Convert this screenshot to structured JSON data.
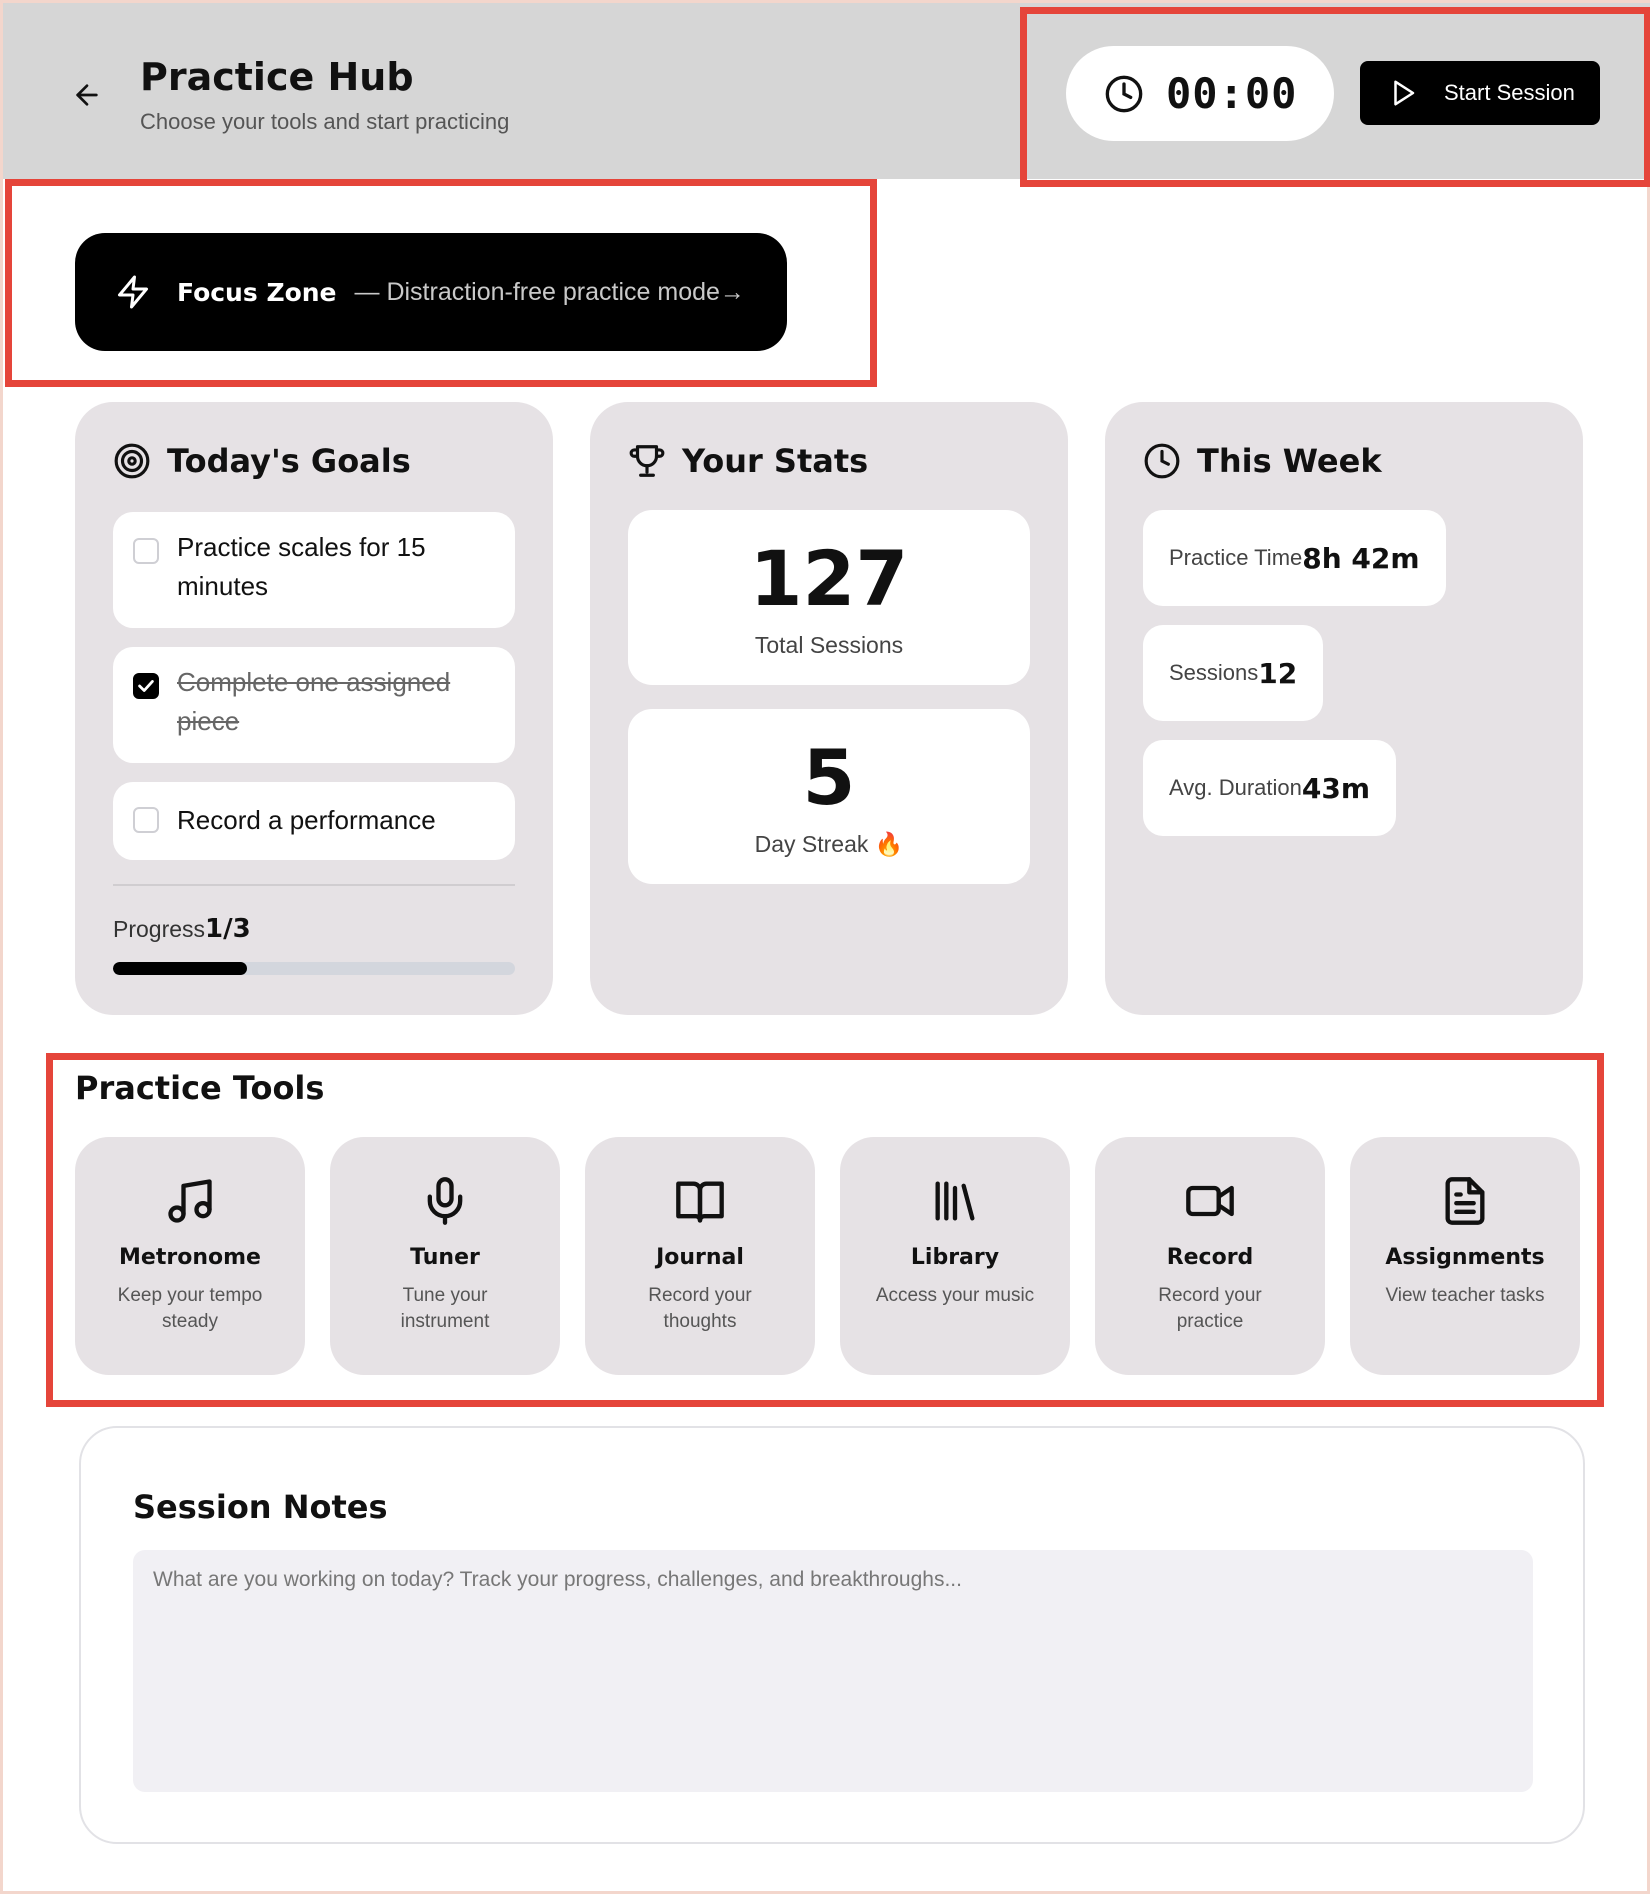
{
  "header": {
    "title": "Practice Hub",
    "subtitle": "Choose your tools and start practicing",
    "timer": "00:00",
    "start_label": "Start Session"
  },
  "focus": {
    "label": "Focus Zone",
    "description": "— Distraction-free practice mode→"
  },
  "goals": {
    "title": "Today's Goals",
    "items": [
      {
        "text": "Practice scales for 15 minutes",
        "checked": false
      },
      {
        "text": "Complete one assigned piece",
        "checked": true
      },
      {
        "text": "Record a performance",
        "checked": false
      }
    ],
    "progress_label": "Progress",
    "progress_value": "1/3",
    "progress_fraction": 0.333
  },
  "stats": {
    "title": "Your Stats",
    "total_sessions": "127",
    "total_sessions_label": "Total Sessions",
    "streak": "5",
    "streak_label": "Day Streak 🔥"
  },
  "week": {
    "title": "This Week",
    "practice_time_label": "Practice Time",
    "practice_time_value": "8h 42m",
    "sessions_label": "Sessions",
    "sessions_value": "12",
    "avg_label": "Avg. Duration",
    "avg_value": "43m"
  },
  "tools": {
    "title": "Practice Tools",
    "items": [
      {
        "name": "Metronome",
        "desc": "Keep your tempo steady",
        "icon": "music-note-icon"
      },
      {
        "name": "Tuner",
        "desc": "Tune your instrument",
        "icon": "microphone-icon"
      },
      {
        "name": "Journal",
        "desc": "Record your thoughts",
        "icon": "book-icon"
      },
      {
        "name": "Library",
        "desc": "Access your music",
        "icon": "library-icon"
      },
      {
        "name": "Record",
        "desc": "Record your practice",
        "icon": "video-camera-icon"
      },
      {
        "name": "Assignments",
        "desc": "View teacher tasks",
        "icon": "document-icon"
      }
    ]
  },
  "notes": {
    "title": "Session Notes",
    "placeholder": "What are you working on today? Track your progress, challenges, and breakthroughs..."
  },
  "colors": {
    "accent": "#000000",
    "highlight": "#e5453a",
    "card_bg": "#e6e2e5",
    "header_bg": "#d6d6d6"
  }
}
